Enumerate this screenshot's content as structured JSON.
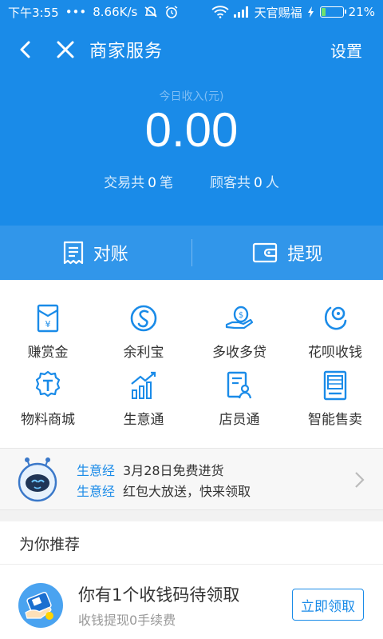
{
  "status_bar": {
    "time": "下午3:55",
    "dots": "•••",
    "speed": "8.66K/s",
    "carrier": "天官赐福",
    "battery": "21%",
    "battery_level": 0.21
  },
  "header": {
    "title": "商家服务",
    "settings_label": "设置"
  },
  "income": {
    "label": "今日收入(元)",
    "value": "0.00",
    "transactions_prefix": "交易共",
    "transactions_count": "0",
    "transactions_unit": "笔",
    "customers_prefix": "顾客共",
    "customers_count": "0",
    "customers_unit": "人"
  },
  "actions": {
    "reconcile_label": "对账",
    "withdraw_label": "提现"
  },
  "services": [
    {
      "label": "赚赏金",
      "icon": "reward-envelope-icon"
    },
    {
      "label": "余利宝",
      "icon": "yulibao-icon"
    },
    {
      "label": "多收多贷",
      "icon": "loan-hand-icon"
    },
    {
      "label": "花呗收钱",
      "icon": "huabei-icon"
    },
    {
      "label": "物料商城",
      "icon": "store-badge-icon"
    },
    {
      "label": "生意通",
      "icon": "bar-chart-icon"
    },
    {
      "label": "店员通",
      "icon": "clerk-icon"
    },
    {
      "label": "智能售卖",
      "icon": "vending-icon"
    }
  ],
  "news": {
    "tag": "生意经",
    "line1": "3月28日免费进货",
    "line2": "红包大放送，快来领取"
  },
  "recommend": {
    "header": "为你推荐",
    "title": "你有1个收钱码待领取",
    "subtitle": "收钱提现0手续费",
    "button_label": "立即领取"
  },
  "colors": {
    "brand_blue": "#1a8be8",
    "action_bar": "#3196ea",
    "text_dark": "#333333",
    "text_gray": "#999999"
  }
}
